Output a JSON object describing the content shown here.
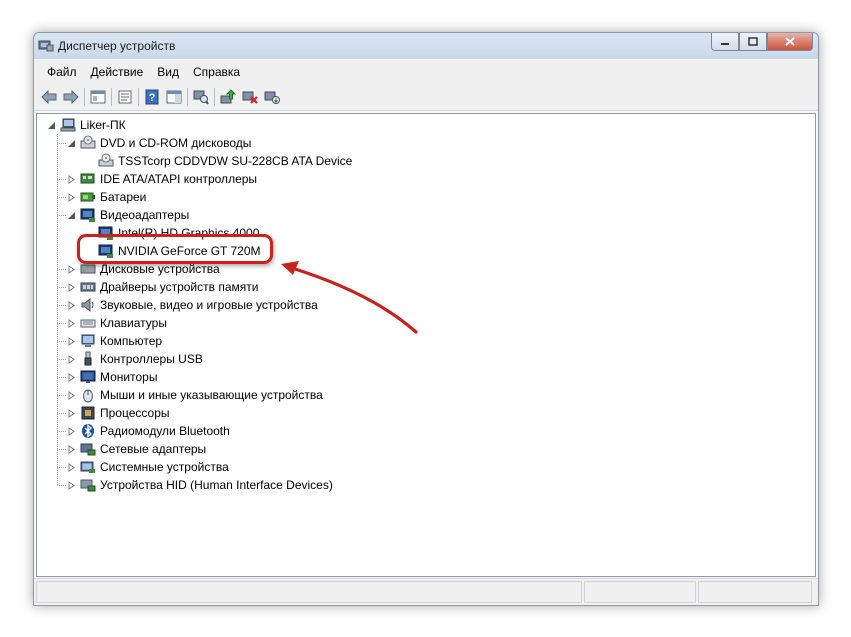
{
  "window": {
    "title": "Диспетчер устройств"
  },
  "menu": [
    "Файл",
    "Действие",
    "Вид",
    "Справка"
  ],
  "tree": {
    "root": "Liker-ПК",
    "items": [
      {
        "label": "DVD и CD-ROM дисководы",
        "icon": "dvd-icon",
        "expanded": true,
        "children": [
          "TSSTcorp CDDVDW SU-228CB ATA Device"
        ]
      },
      {
        "label": "IDE ATA/ATAPI контроллеры",
        "icon": "ide-icon"
      },
      {
        "label": "Батареи",
        "icon": "battery-icon"
      },
      {
        "label": "Видеоадаптеры",
        "icon": "display-adapter-icon",
        "expanded": true,
        "children": [
          "Intel(R) HD Graphics 4000",
          "NVIDIA GeForce GT 720M"
        ]
      },
      {
        "label": "Дисковые устройства",
        "icon": "disk-icon"
      },
      {
        "label": "Драйверы устройств памяти",
        "icon": "memory-icon"
      },
      {
        "label": "Звуковые, видео и игровые устройства",
        "icon": "speaker-icon"
      },
      {
        "label": "Клавиатуры",
        "icon": "keyboard-icon"
      },
      {
        "label": "Компьютер",
        "icon": "computer-icon"
      },
      {
        "label": "Контроллеры USB",
        "icon": "usb-icon"
      },
      {
        "label": "Мониторы",
        "icon": "monitor-icon"
      },
      {
        "label": "Мыши и иные указывающие устройства",
        "icon": "mouse-icon"
      },
      {
        "label": "Процессоры",
        "icon": "processor-icon"
      },
      {
        "label": "Радиомодули Bluetooth",
        "icon": "bluetooth-icon"
      },
      {
        "label": "Сетевые адаптеры",
        "icon": "network-icon"
      },
      {
        "label": "Системные устройства",
        "icon": "system-icon"
      },
      {
        "label": "Устройства HID (Human Interface Devices)",
        "icon": "hid-icon"
      }
    ]
  },
  "annotation": {
    "color": "#d0201b",
    "target": "NVIDIA GeForce GT 720M"
  }
}
